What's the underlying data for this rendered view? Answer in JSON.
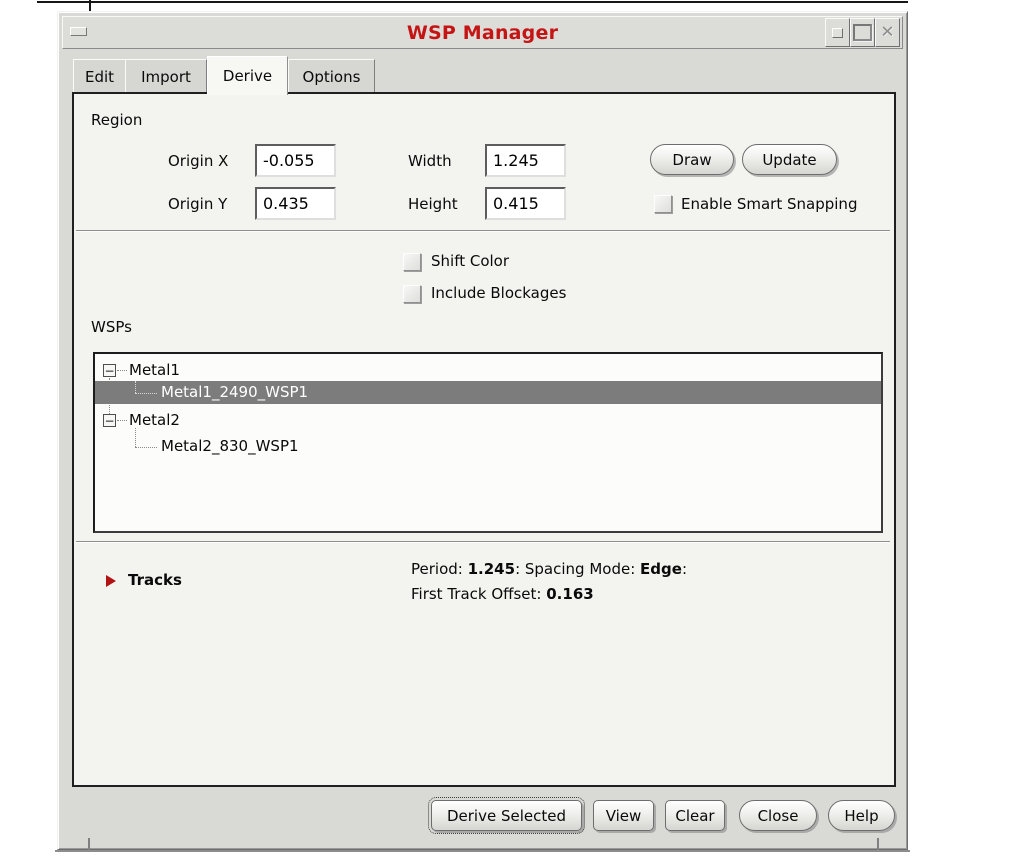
{
  "window": {
    "title": "WSP Manager",
    "title_color": "#c51414",
    "icons": {
      "menu": "window-menu-dash",
      "iconify": "iconify-dot",
      "maximize": "maximize-square",
      "close_glyph": "✕"
    }
  },
  "tabs": [
    {
      "label": "Edit",
      "active": false
    },
    {
      "label": "Import",
      "active": false
    },
    {
      "label": "Derive",
      "active": true
    },
    {
      "label": "Options",
      "active": false
    }
  ],
  "region": {
    "section_label": "Region",
    "origin_x": {
      "label": "Origin X",
      "value": "-0.055"
    },
    "width": {
      "label": "Width",
      "value": "1.245"
    },
    "origin_y": {
      "label": "Origin Y",
      "value": "0.435"
    },
    "height": {
      "label": "Height",
      "value": "0.415"
    },
    "draw_button": "Draw",
    "update_button": "Update",
    "smart_snapping": {
      "label": "Enable Smart Snapping",
      "checked": false
    }
  },
  "display_options": {
    "shift_color": {
      "label": "Shift Color",
      "checked": false
    },
    "include_blockages": {
      "label": "Include Blockages",
      "checked": false
    }
  },
  "wsps": {
    "section_label": "WSPs",
    "selection_color": "#7c7c7c",
    "expander_glyph": "−",
    "tree": [
      {
        "label": "Metal1",
        "expanded": true,
        "children": [
          {
            "label": "Metal1_2490_WSP1",
            "selected": true
          }
        ]
      },
      {
        "label": "Metal2",
        "expanded": true,
        "children": [
          {
            "label": "Metal2_830_WSP1",
            "selected": false
          }
        ]
      }
    ]
  },
  "tracks": {
    "section_label": "Tracks",
    "arrow_color": "#b31212",
    "info": {
      "period_label": "Period: ",
      "period_value": "1.245",
      "spacing_label": ": Spacing Mode: ",
      "spacing_value": "Edge",
      "spacing_suffix": ":",
      "offset_label": "First Track Offset: ",
      "offset_value": "0.163"
    }
  },
  "footer": {
    "buttons": [
      {
        "label": "Derive Selected",
        "focused": true
      },
      {
        "label": "View",
        "focused": false
      },
      {
        "label": "Clear",
        "focused": false
      },
      {
        "label": "Close",
        "focused": false
      },
      {
        "label": "Help",
        "focused": false
      }
    ]
  }
}
